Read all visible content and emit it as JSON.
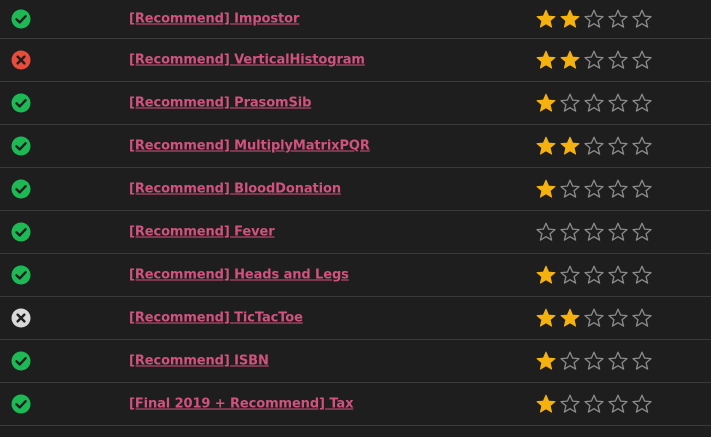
{
  "colors": {
    "background": "#1e1e1e",
    "divider": "#3a3a3a",
    "link": "#d2527f",
    "star_filled": "#f5b20f",
    "star_empty": "#8c8c8c",
    "status_pass": "#1db954",
    "status_fail": "#e74c3c",
    "status_unknown": "#d9d9d9"
  },
  "problems": [
    {
      "status": "pass",
      "title": "[Recommend] Impostor",
      "rating": 2,
      "max_rating": 5
    },
    {
      "status": "fail",
      "title": "[Recommend] VerticalHistogram",
      "rating": 2,
      "max_rating": 5
    },
    {
      "status": "pass",
      "title": "[Recommend] PrasomSib",
      "rating": 1,
      "max_rating": 5
    },
    {
      "status": "pass",
      "title": "[Recommend] MultiplyMatrixPQR",
      "rating": 2,
      "max_rating": 5
    },
    {
      "status": "pass",
      "title": "[Recommend] BloodDonation",
      "rating": 1,
      "max_rating": 5
    },
    {
      "status": "pass",
      "title": "[Recommend] Fever",
      "rating": 0,
      "max_rating": 5
    },
    {
      "status": "pass",
      "title": "[Recommend] Heads and Legs",
      "rating": 1,
      "max_rating": 5
    },
    {
      "status": "unknown",
      "title": "[Recommend] TicTacToe",
      "rating": 2,
      "max_rating": 5
    },
    {
      "status": "pass",
      "title": "[Recommend] ISBN",
      "rating": 1,
      "max_rating": 5
    },
    {
      "status": "pass",
      "title": "[Final 2019 + Recommend] Tax",
      "rating": 1,
      "max_rating": 5
    }
  ]
}
